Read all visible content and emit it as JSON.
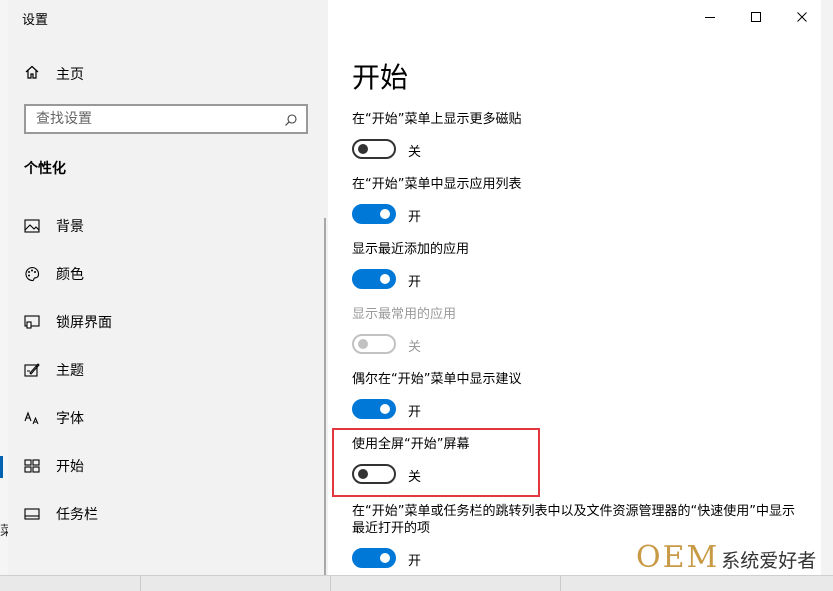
{
  "app": {
    "title": "设置"
  },
  "sidebar": {
    "home_label": "主页",
    "search_placeholder": "查找设置",
    "section_header": "个性化",
    "items": [
      {
        "label": "背景",
        "icon": "image-icon"
      },
      {
        "label": "颜色",
        "icon": "palette-icon"
      },
      {
        "label": "锁屏界面",
        "icon": "lock-screen-icon"
      },
      {
        "label": "主题",
        "icon": "theme-icon"
      },
      {
        "label": "字体",
        "icon": "font-icon"
      },
      {
        "label": "开始",
        "icon": "start-icon",
        "selected": true
      },
      {
        "label": "任务栏",
        "icon": "taskbar-icon"
      }
    ]
  },
  "main": {
    "title": "开始",
    "settings": [
      {
        "label": "在“开始”菜单上显示更多磁贴",
        "state": "关",
        "on": false,
        "enabled": true
      },
      {
        "label": "在“开始”菜单中显示应用列表",
        "state": "开",
        "on": true,
        "enabled": true
      },
      {
        "label": "显示最近添加的应用",
        "state": "开",
        "on": true,
        "enabled": true
      },
      {
        "label": "显示最常用的应用",
        "state": "关",
        "on": false,
        "enabled": false
      },
      {
        "label": "偶尔在“开始”菜单中显示建议",
        "state": "开",
        "on": true,
        "enabled": true
      },
      {
        "label": "使用全屏“开始”屏幕",
        "state": "关",
        "on": false,
        "enabled": true,
        "highlighted": true
      },
      {
        "label": "在“开始”菜单或任务栏的跳转列表中以及文件资源管理器的“快速使用”中显示最近打开的项",
        "state": "开",
        "on": true,
        "enabled": true
      }
    ]
  },
  "window_controls": {
    "minimize": "minimize-icon",
    "maximize": "maximize-icon",
    "close": "close-icon"
  },
  "watermark": {
    "brand": "OEM",
    "text": "系统爱好者"
  },
  "colors": {
    "accent": "#0078d7",
    "highlight": "#e3373f",
    "sidebar_bg": "#f2f2f2",
    "watermark_gold": "#c89a46"
  }
}
